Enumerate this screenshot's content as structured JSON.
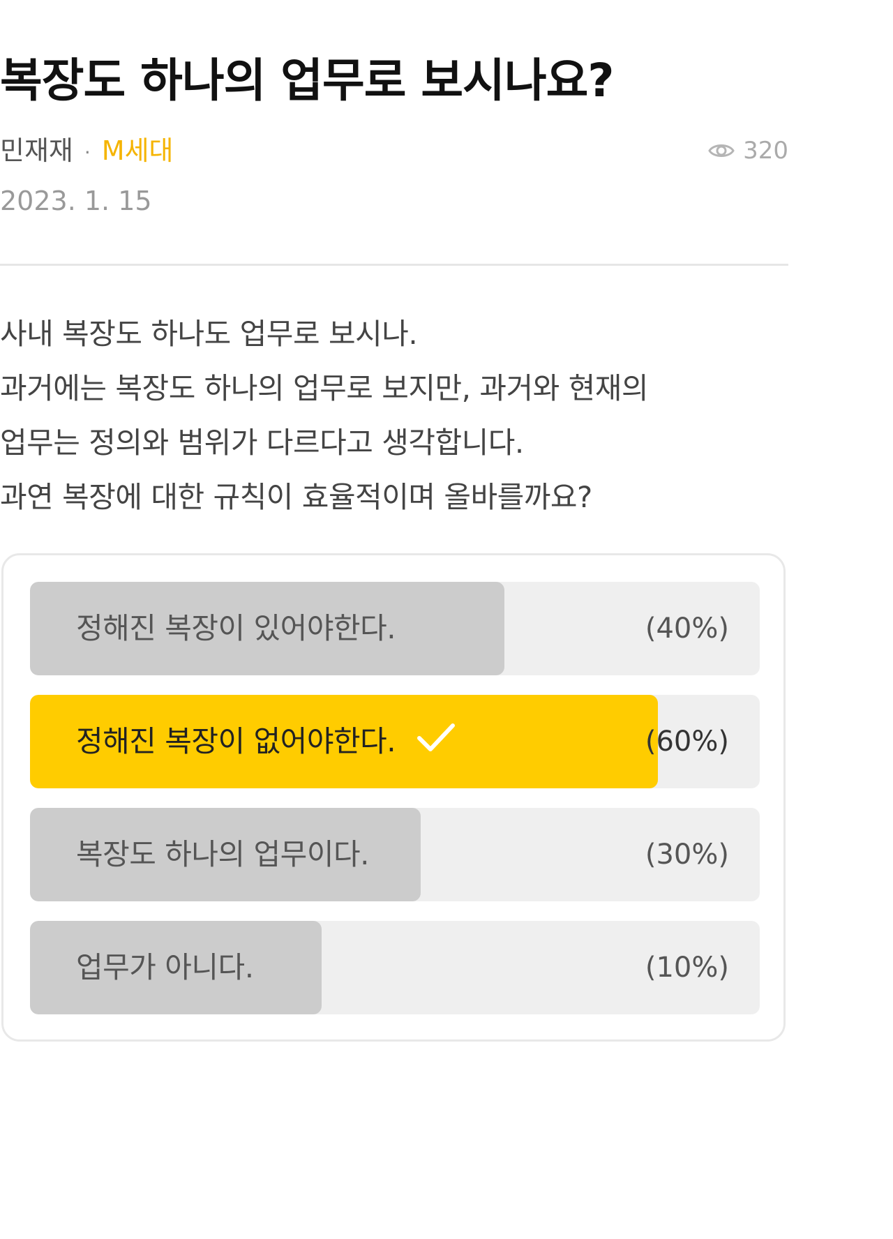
{
  "post": {
    "title": "복장도 하나의 업무로 보시나요?",
    "author": "민재재",
    "separator": "·",
    "category": "M세대",
    "views": "320",
    "date": "2023. 1. 15",
    "body_lines": [
      "사내 복장도 하나도 업무로 보시나.",
      "과거에는 복장도 하나의 업무로 보지만,  과거와 현재의",
      "업무는 정의와 범위가 다르다고 생각합니다.",
      "과연 복장에 대한 규칙이 효율적이며 올바를까요?"
    ]
  },
  "poll": {
    "options": [
      {
        "label": "정해진 복장이 있어야한다.",
        "percent_text": "(40%)",
        "fill_fraction": 0.65,
        "selected": false
      },
      {
        "label": "정해진 복장이 없어야한다.",
        "percent_text": "(60%)",
        "fill_fraction": 0.86,
        "selected": true
      },
      {
        "label": "복장도 하나의 업무이다.",
        "percent_text": "(30%)",
        "fill_fraction": 0.535,
        "selected": false
      },
      {
        "label": "업무가 아니다.",
        "percent_text": "(10%)",
        "fill_fraction": 0.4,
        "selected": false
      }
    ]
  },
  "colors": {
    "accent": "#ffcc00",
    "category": "#f5b400",
    "bar_fill": "#cccccc",
    "bar_track": "#efefef"
  },
  "icons": {
    "views": "eye-icon",
    "selected": "check-icon"
  }
}
